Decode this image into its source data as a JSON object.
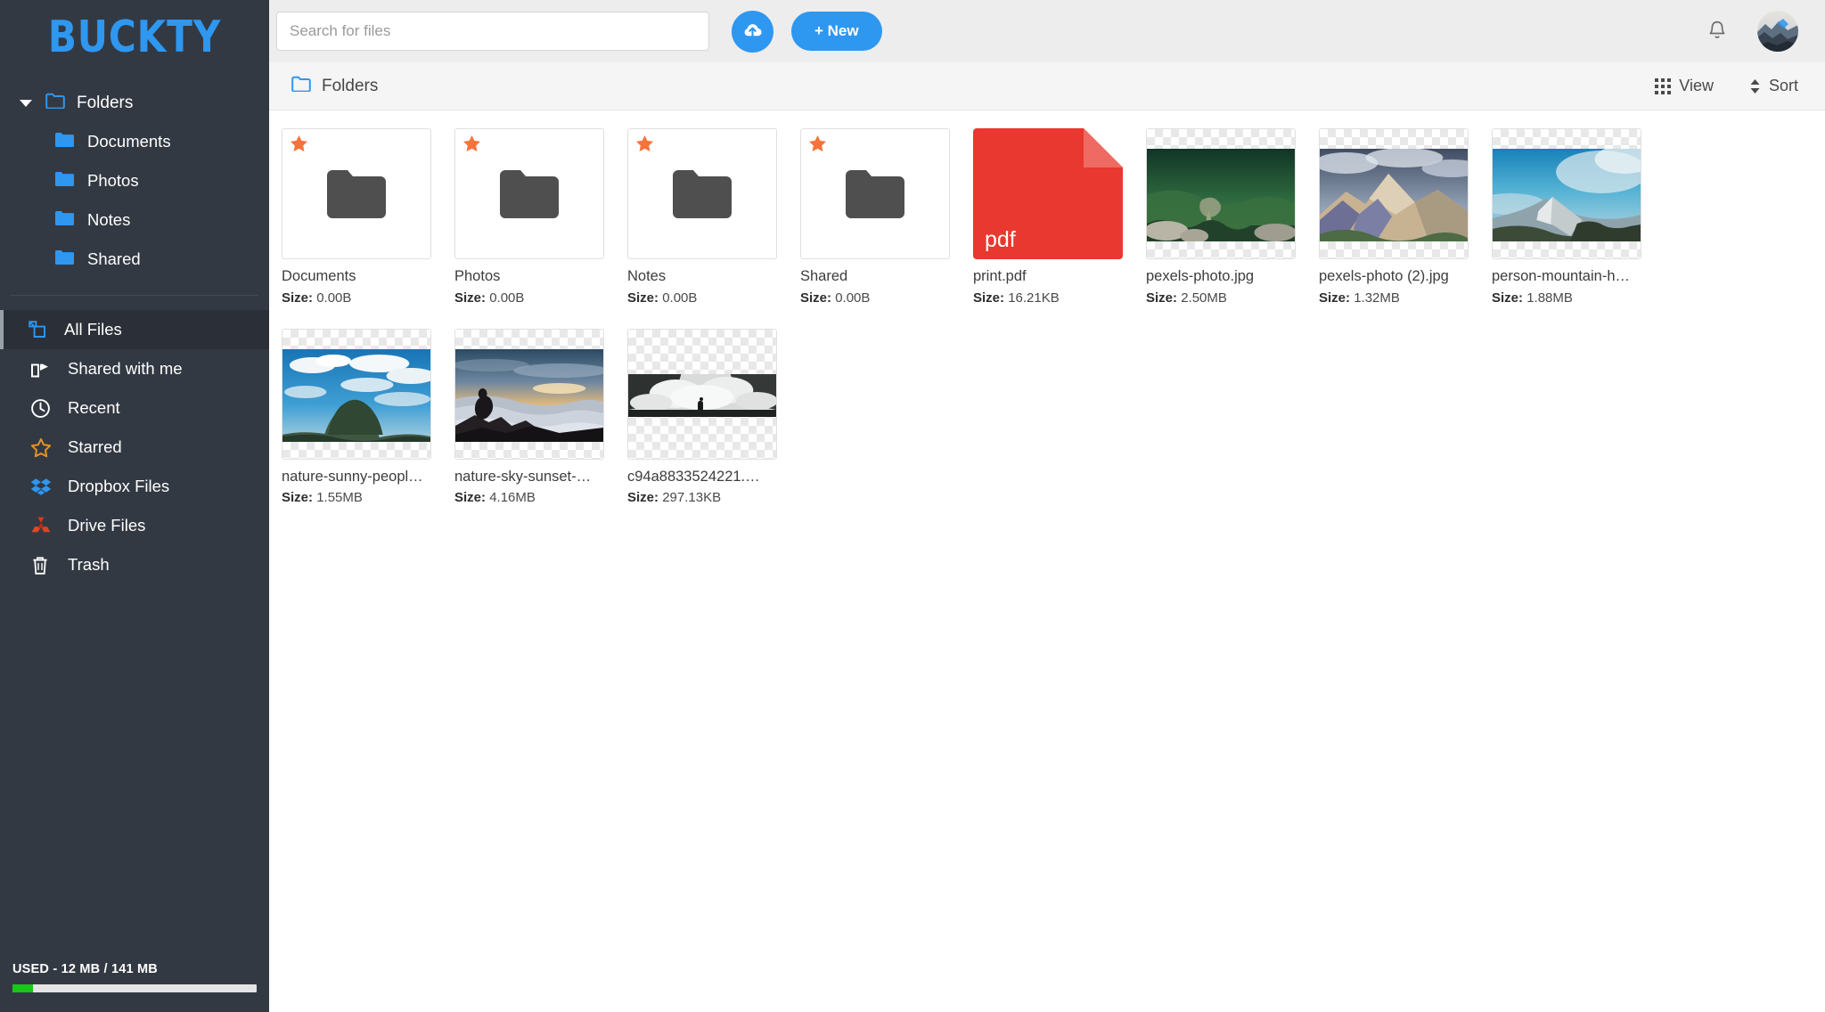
{
  "app": {
    "logo": "BUCKTY"
  },
  "sidebar": {
    "tree": {
      "root_label": "Folders",
      "children": [
        {
          "label": "Documents"
        },
        {
          "label": "Photos"
        },
        {
          "label": "Notes"
        },
        {
          "label": "Shared"
        }
      ]
    },
    "nav": [
      {
        "label": "All Files",
        "icon": "files-icon",
        "active": true
      },
      {
        "label": "Shared with me",
        "icon": "share-icon",
        "active": false
      },
      {
        "label": "Recent",
        "icon": "clock-icon",
        "active": false
      },
      {
        "label": "Starred",
        "icon": "star-icon",
        "active": false
      },
      {
        "label": "Dropbox Files",
        "icon": "dropbox-icon",
        "active": false
      },
      {
        "label": "Drive Files",
        "icon": "drive-icon",
        "active": false
      },
      {
        "label": "Trash",
        "icon": "trash-icon",
        "active": false
      }
    ],
    "storage": {
      "label": "USED - 12 MB / 141 MB",
      "used_text": "12 MB",
      "total_text": "141 MB",
      "percent": 8.5,
      "bar_color": "#18c718"
    }
  },
  "topbar": {
    "search_placeholder": "Search for files",
    "search_value": "",
    "upload_icon": "cloud-upload-icon",
    "new_label": "+ New",
    "bell_icon": "bell-icon",
    "avatar_icon": "user-avatar"
  },
  "crumbbar": {
    "breadcrumb": "Folders",
    "view_label": "View",
    "sort_label": "Sort"
  },
  "colors": {
    "accent": "#2e97f0",
    "sidebar_bg": "#333943",
    "sidebar_active_bg": "#2b3038",
    "star": "#f4743b",
    "starred_nav": "#e8921f",
    "pdf_red": "#e8382f",
    "storage_green": "#18c718",
    "topbar_bg": "#ededed",
    "crumbbar_bg": "#f5f5f5"
  },
  "files": [
    {
      "name": "Documents",
      "size_label": "Size:",
      "size": "0.00B",
      "kind": "folder",
      "starred": true
    },
    {
      "name": "Photos",
      "size_label": "Size:",
      "size": "0.00B",
      "kind": "folder",
      "starred": true
    },
    {
      "name": "Notes",
      "size_label": "Size:",
      "size": "0.00B",
      "kind": "folder",
      "starred": true
    },
    {
      "name": "Shared",
      "size_label": "Size:",
      "size": "0.00B",
      "kind": "folder",
      "starred": true
    },
    {
      "name": "print.pdf",
      "size_label": "Size:",
      "size": "16.21KB",
      "kind": "pdf",
      "starred": false,
      "ext_label": "pdf"
    },
    {
      "name": "pexels-photo.jpg",
      "size_label": "Size:",
      "size": "2.50MB",
      "kind": "image",
      "starred": false,
      "image": "green-valley"
    },
    {
      "name": "pexels-photo (2).jpg",
      "size_label": "Size:",
      "size": "1.32MB",
      "kind": "image",
      "starred": false,
      "image": "rocky-peak"
    },
    {
      "name": "person-mountain-h…",
      "size_label": "Size:",
      "size": "1.88MB",
      "kind": "image",
      "starred": false,
      "image": "blue-sky-ridge"
    },
    {
      "name": "nature-sunny-peopl…",
      "size_label": "Size:",
      "size": "1.55MB",
      "kind": "image",
      "starred": false,
      "image": "sunny-clouds"
    },
    {
      "name": "nature-sky-sunset-…",
      "size_label": "Size:",
      "size": "4.16MB",
      "kind": "image",
      "starred": false,
      "image": "cloud-sea-sunset"
    },
    {
      "name": "c94a8833524221.…",
      "size_label": "Size:",
      "size": "297.13KB",
      "kind": "image",
      "starred": false,
      "image": "bw-panorama"
    }
  ]
}
